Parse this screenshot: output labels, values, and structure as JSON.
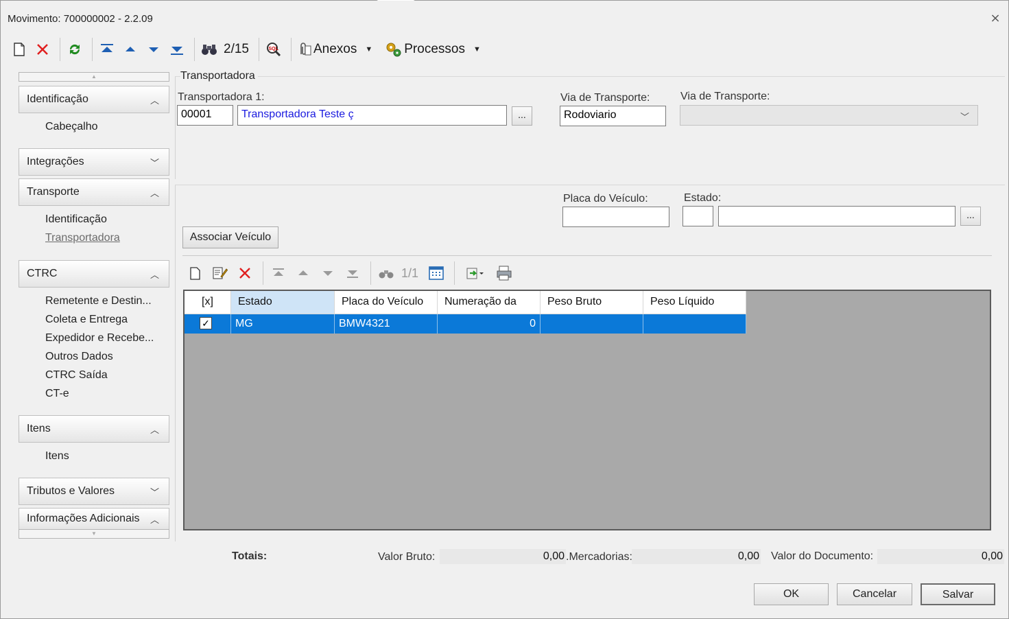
{
  "window": {
    "title": "Movimento: 700000002 - 2.2.09",
    "close_glyph": "⨯"
  },
  "toolbar": {
    "record_counter": "2/15",
    "anexos_label": "Anexos",
    "processos_label": "Processos"
  },
  "sidebar": {
    "groups": [
      {
        "label": "Identificação",
        "items": [
          "Cabeçalho"
        ]
      },
      {
        "label": "Integrações",
        "items": []
      },
      {
        "label": "Transporte",
        "items": [
          "Identificação",
          "Transportadora"
        ]
      },
      {
        "label": "CTRC",
        "items": [
          "Remetente e Destin...",
          "Coleta e Entrega",
          "Expedidor e Recebe...",
          "Outros Dados",
          "CTRC Saída",
          "CT-e"
        ]
      },
      {
        "label": "Itens",
        "items": [
          "Itens"
        ]
      },
      {
        "label": "Tributos e Valores",
        "items": []
      },
      {
        "label": "Informações Adicionais",
        "items": []
      }
    ]
  },
  "transportadora": {
    "section_title": "Transportadora",
    "transportadora1_label": "Transportadora 1:",
    "transportadora1_code": "00001",
    "transportadora1_name": "Transportadora Teste ç",
    "ellipsis": "...",
    "via_transporte_label": "Via de Transporte:",
    "via_transporte_value": "Rodoviario",
    "via_transporte2_label": "Via de Transporte:",
    "via_transporte2_value": ""
  },
  "veiculo": {
    "placa_label": "Placa do Veículo:",
    "placa_value": "",
    "estado_label": "Estado:",
    "estado_code": "",
    "estado_name": "",
    "associar_button": "Associar Veículo"
  },
  "grid_toolbar": {
    "counter": "1/1"
  },
  "grid": {
    "columns": [
      "[x]",
      "Estado",
      "Placa do Veículo",
      "Numeração da",
      "Peso Bruto",
      "Peso Líquido"
    ],
    "rows": [
      {
        "checked": true,
        "estado": "MG",
        "placa": "BMW4321",
        "numeracao": "0",
        "peso_bruto": "",
        "peso_liquido": ""
      }
    ]
  },
  "totals": {
    "label": "Totais:",
    "valor_bruto_label": "Valor Bruto:",
    "valor_bruto_value": "0,00",
    "mercadorias_label": ".Mercadorias:",
    "mercadorias_value": "0,00",
    "valor_documento_label": "Valor do Documento:",
    "valor_documento_value": "0,00"
  },
  "footer": {
    "ok_label": "OK",
    "cancel_label": "Cancelar",
    "save_label": "Salvar"
  },
  "colors": {
    "selection_blue": "#0b79d8",
    "header_selected": "#cfe4f7",
    "grid_background": "#a9a9a9",
    "delete_red": "#e02020"
  }
}
